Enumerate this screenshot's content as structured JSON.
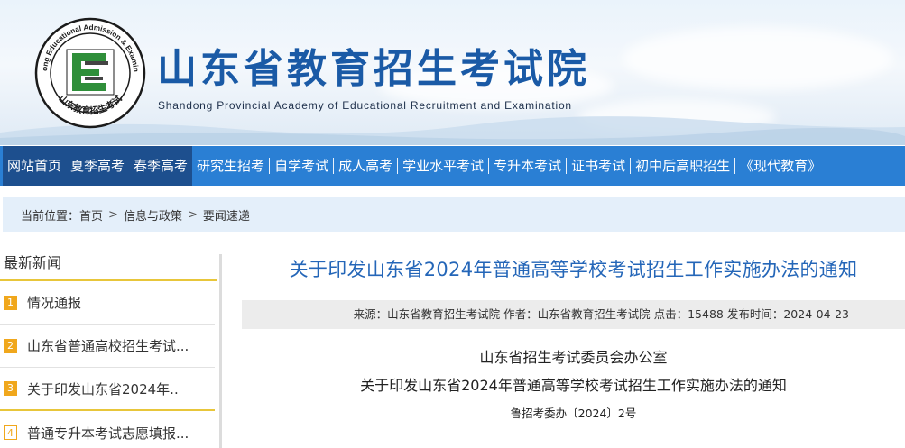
{
  "header": {
    "title": "山东省教育招生考试院",
    "subtitle": "Shandong Provincial Academy of Educational Recruitment and Examination",
    "logo": {
      "ring_text_en": "Shandong Educational Admission & Examinations",
      "ring_text_cn": "山东教育招生考试",
      "letter": "E",
      "colors": {
        "ring": "#1b1b1b",
        "letter": "#2f8f3a"
      }
    }
  },
  "nav": {
    "items": [
      {
        "label": "网站首页",
        "active": true
      },
      {
        "label": "夏季高考",
        "active": true
      },
      {
        "label": "春季高考",
        "active": true
      },
      {
        "label": "研究生招考",
        "active": false
      },
      {
        "label": "自学考试",
        "active": false
      },
      {
        "label": "成人高考",
        "active": false
      },
      {
        "label": "学业水平考试",
        "active": false
      },
      {
        "label": "专升本考试",
        "active": false
      },
      {
        "label": "证书考试",
        "active": false
      },
      {
        "label": "初中后高职招生",
        "active": false
      },
      {
        "label": "《现代教育》",
        "active": false
      }
    ],
    "colors": {
      "bar": "#2a7fd4",
      "active": "#1d4f8e"
    }
  },
  "breadcrumb": {
    "prefix": "当前位置：",
    "items": [
      "首页",
      "信息与政策",
      "要闻速递"
    ],
    "separator": ">"
  },
  "sidebar": {
    "title": "最新新闻",
    "items": [
      {
        "num": "1",
        "text": "情况通报"
      },
      {
        "num": "2",
        "text": "山东省普通高校招生考试..."
      },
      {
        "num": "3",
        "text": "关于印发山东省2024年.."
      },
      {
        "num": "4",
        "text": "普通专升本考试志愿填报..."
      }
    ],
    "accent": "#f0a71c"
  },
  "article": {
    "title": "关于印发山东省2024年普通高等学校考试招生工作实施办法的通知",
    "meta": "来源：山东省教育招生考试院 作者：山东省教育招生考试院 点击：15488 发布时间：2024-04-23",
    "org": "山东省招生考试委员会办公室",
    "doc_title": "关于印发山东省2024年普通高等学校考试招生工作实施办法的通知",
    "doc_no": "鲁招考委办〔2024〕2号",
    "title_color": "#2466b8"
  }
}
